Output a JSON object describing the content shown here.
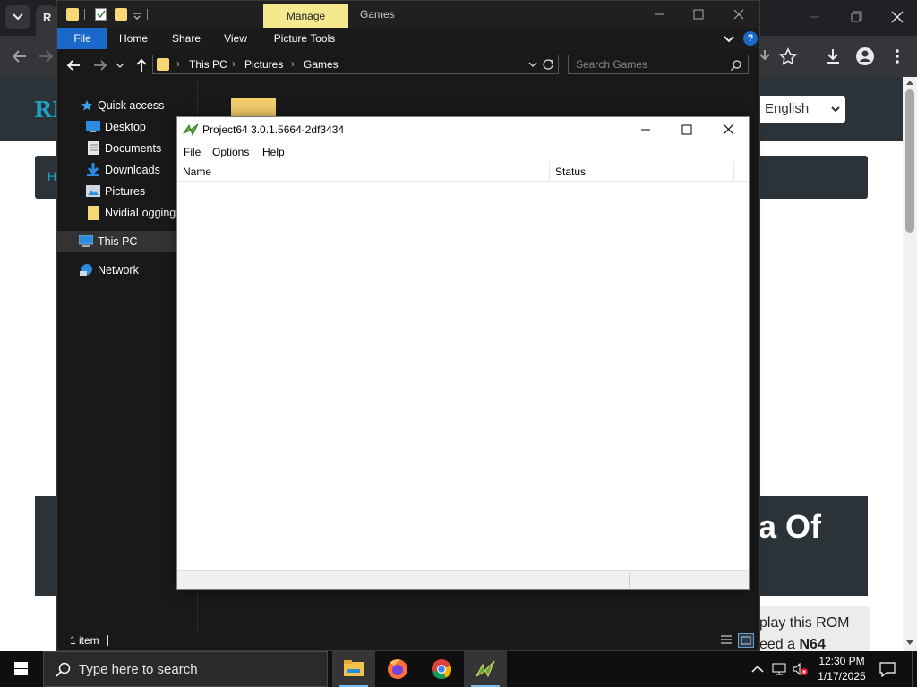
{
  "browser": {
    "language_select": "English",
    "heading_fragment": "a Of",
    "para_line1": "play this ROM",
    "para_line2_prefix": "eed a ",
    "para_line2_bold": "N64",
    "banner_text": "RE",
    "breadcrumb_text": "H"
  },
  "explorer": {
    "title": "Games",
    "context_tab": "Manage",
    "ribbon_tabs": [
      "File",
      "Home",
      "Share",
      "View",
      "Picture Tools"
    ],
    "breadcrumb": [
      "This PC",
      "Pictures",
      "Games"
    ],
    "search_placeholder": "Search Games",
    "nav": {
      "quick_access": "Quick access",
      "desktop": "Desktop",
      "documents": "Documents",
      "downloads": "Downloads",
      "pictures": "Pictures",
      "nvidia": "NvidiaLogging",
      "this_pc": "This PC",
      "network": "Network"
    },
    "status": "1 item"
  },
  "project64": {
    "title": "Project64 3.0.1.5664-2df3434",
    "menu": [
      "File",
      "Options",
      "Help"
    ],
    "columns": [
      "Name",
      "Status"
    ]
  },
  "taskbar": {
    "search_placeholder": "Type here to search",
    "time": "12:30 PM",
    "date": "1/17/2025"
  }
}
